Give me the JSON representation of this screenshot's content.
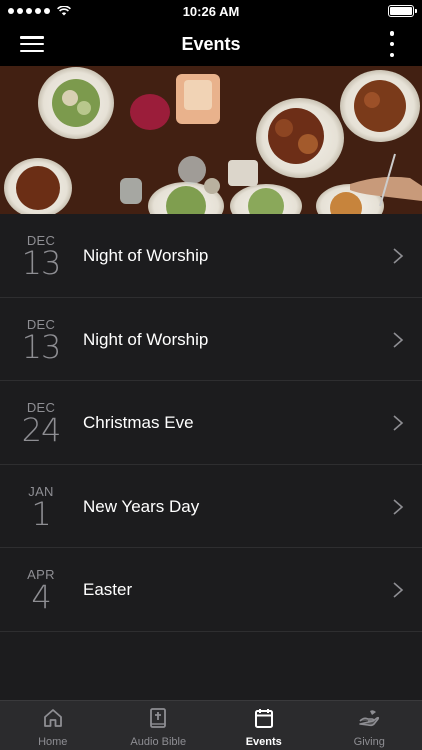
{
  "status_bar": {
    "time": "10:26 AM",
    "signal_bars": 5
  },
  "header": {
    "title": "Events",
    "menu_icon": "hamburger-icon",
    "more_icon": "more-vertical-icon"
  },
  "hero": {
    "icon": "food-table-image"
  },
  "events": [
    {
      "month": "DEC",
      "day": "13",
      "title": "Night of Worship"
    },
    {
      "month": "DEC",
      "day": "13",
      "title": "Night of Worship"
    },
    {
      "month": "DEC",
      "day": "24",
      "title": "Christmas Eve"
    },
    {
      "month": "JAN",
      "day": "1",
      "title": "New Years Day"
    },
    {
      "month": "APR",
      "day": "4",
      "title": "Easter"
    }
  ],
  "tabs": [
    {
      "label": "Home",
      "icon": "home-icon",
      "active": false
    },
    {
      "label": "Audio Bible",
      "icon": "bible-icon",
      "active": false
    },
    {
      "label": "Events",
      "icon": "calendar-icon",
      "active": true
    },
    {
      "label": "Giving",
      "icon": "giving-hand-icon",
      "active": false
    }
  ],
  "colors": {
    "background": "#1c1c1e",
    "header": "#000000",
    "tab_bar": "#2b2b2d",
    "muted_text": "#8e8e93"
  }
}
